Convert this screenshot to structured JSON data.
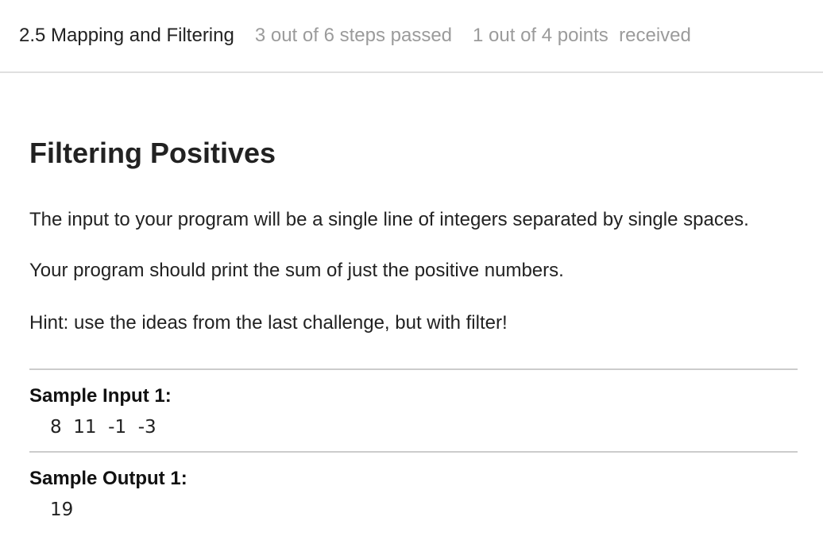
{
  "header": {
    "lesson_title": "2.5 Mapping and Filtering",
    "steps_status": "3 out of 6 steps passed",
    "points_status": "1 out of 4 points  received"
  },
  "problem": {
    "title": "Filtering Positives",
    "paragraphs": [
      "The input to your program will be a single line of integers separated by single spaces.",
      "Your program should print the sum of just the positive numbers.",
      "Hint: use the ideas from the last challenge, but with filter!"
    ],
    "samples": [
      {
        "label": "Sample Input 1:",
        "value": "8  11  -1  -3"
      },
      {
        "label": "Sample Output 1:",
        "value": "19"
      }
    ]
  }
}
